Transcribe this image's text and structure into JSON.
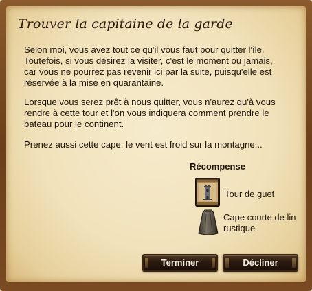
{
  "quest": {
    "title": "Trouver la capitaine de la garde",
    "paragraphs": [
      "Selon moi, vous avez tout ce qu'il vous faut pour quitter l'île. Toutefois, si vous désirez la visiter, c'est le moment ou jamais, car vous ne pourrez pas revenir ici par la suite, puisqu'elle est réservée à la mise en quarantaine.",
      "Lorsque vous serez prêt à nous quitter, vous n'aurez qu'à vous rendre à cette tour et l'on vous indiquera comment prendre le bateau pour le continent.",
      "Prenez aussi cette cape, le vent est froid sur la montagne..."
    ]
  },
  "reward": {
    "title": "Récompense",
    "items": [
      {
        "label": "Tour de guet",
        "icon": "watchtower-scroll-icon"
      },
      {
        "label": "Cape courte de lin rustique",
        "icon": "cape-icon"
      }
    ]
  },
  "buttons": {
    "finish": "Terminer",
    "decline": "Décliner"
  }
}
